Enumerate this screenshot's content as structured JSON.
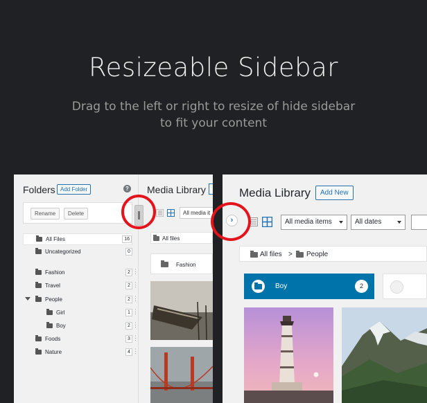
{
  "hero": {
    "title": "Resizeable Sidebar",
    "subtitle_line1": "Drag to the left or right to resize of hide sidebar",
    "subtitle_line2": "to fit your content"
  },
  "left_panel": {
    "sidebar": {
      "heading": "Folders",
      "add_folder_label": "Add Folder",
      "help_label": "?",
      "rename_label": "Rename",
      "delete_label": "Delete",
      "items": [
        {
          "label": "All Files",
          "count": "16"
        },
        {
          "label": "Uncategorized",
          "count": "0"
        },
        {
          "label": "Fashion",
          "count": "2"
        },
        {
          "label": "Travel",
          "count": "2"
        },
        {
          "label": "People",
          "count": "2"
        },
        {
          "label": "Girl",
          "count": "1"
        },
        {
          "label": "Boy",
          "count": "2"
        },
        {
          "label": "Foods",
          "count": "3"
        },
        {
          "label": "Nature",
          "count": "4"
        }
      ]
    },
    "media": {
      "title": "Media Library",
      "filter_label": "All media it",
      "breadcrumb": "All files",
      "folder_card": "Fashion"
    }
  },
  "right_panel": {
    "title": "Media Library",
    "add_new_label": "Add New",
    "expand_glyph": "›",
    "filter_media": "All media items",
    "filter_dates": "All dates",
    "breadcrumb_root": "All files",
    "breadcrumb_sep": ">",
    "breadcrumb_current": "People",
    "folder_active": {
      "label": "Boy",
      "count": "2"
    }
  },
  "colors": {
    "background": "#202124",
    "accent_blue": "#0073aa",
    "highlight_red": "#e3141b"
  }
}
